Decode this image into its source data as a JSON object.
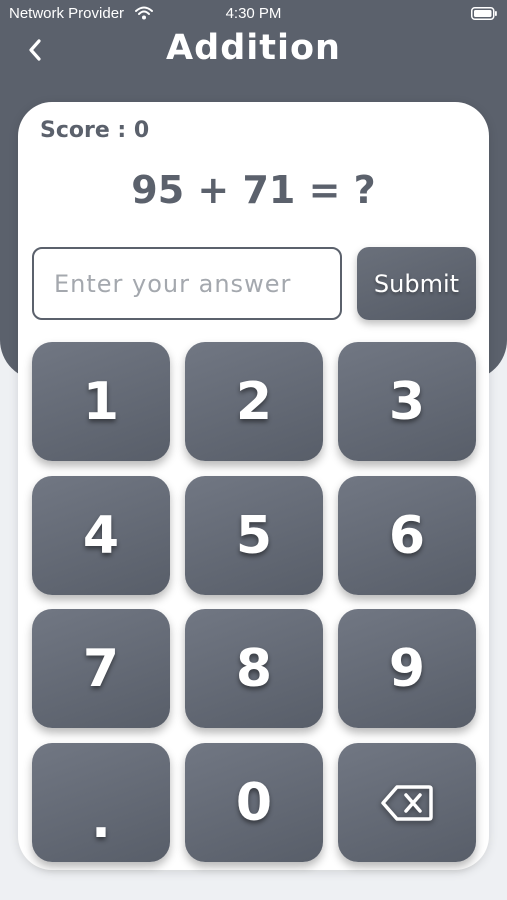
{
  "status_bar": {
    "carrier": "Network Provider",
    "time": "4:30 PM",
    "wifi_icon": "wifi-icon",
    "battery_icon": "battery-icon"
  },
  "header": {
    "title": "Addition",
    "back_icon": "chevron-left-icon",
    "background_color": "#5b616c"
  },
  "game": {
    "score": "Score : 0",
    "question": "95 + 71 = ?"
  },
  "answer": {
    "value": "",
    "placeholder": "Enter your answer"
  },
  "submit": {
    "label": "Submit"
  },
  "keypad": {
    "keys": [
      "1",
      "2",
      "3",
      "4",
      "5",
      "6",
      "7",
      "8",
      "9",
      ".",
      "0"
    ],
    "backspace_icon": "backspace-icon"
  },
  "colors": {
    "accent": "#5b616c",
    "key_gradient_start": "#717783",
    "key_gradient_end": "#585e69",
    "background": "#eef0f3",
    "card": "#ffffff"
  }
}
